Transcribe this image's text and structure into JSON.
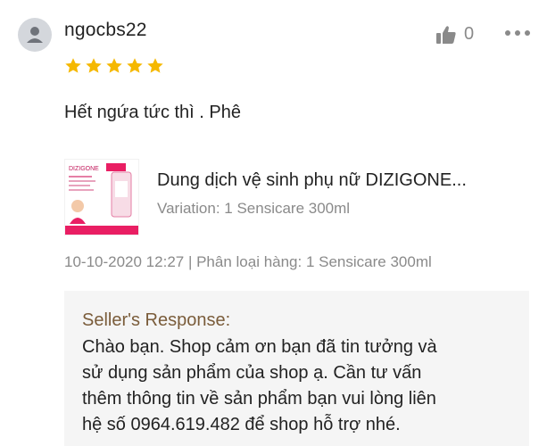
{
  "review": {
    "username": "ngocbs22",
    "like_count": "0",
    "rating": 5,
    "comment": "Hết ngứa tức thì . Phê",
    "star_color": "#f5b800"
  },
  "product": {
    "name": "Dung dịch vệ sinh phụ nữ DIZIGONE...",
    "variation": "Variation: 1 Sensicare 300ml"
  },
  "meta": "10-10-2020 12:27 | Phân loại hàng: 1 Sensicare 300ml",
  "seller_response": {
    "title": "Seller's Response:",
    "lines": [
      "Chào bạn. Shop cảm ơn bạn đã tin tưởng và",
      "sử dụng sản phẩm của shop ạ. Cần tư vấn",
      "thêm thông tin về sản phẩm bạn vui lòng liên",
      "hệ số 0964.619.482 để shop hỗ trợ nhé."
    ]
  },
  "icons": {
    "avatar": "user-avatar-icon",
    "like": "thumbs-up-icon",
    "more": "more-options-icon",
    "star": "star-icon"
  }
}
